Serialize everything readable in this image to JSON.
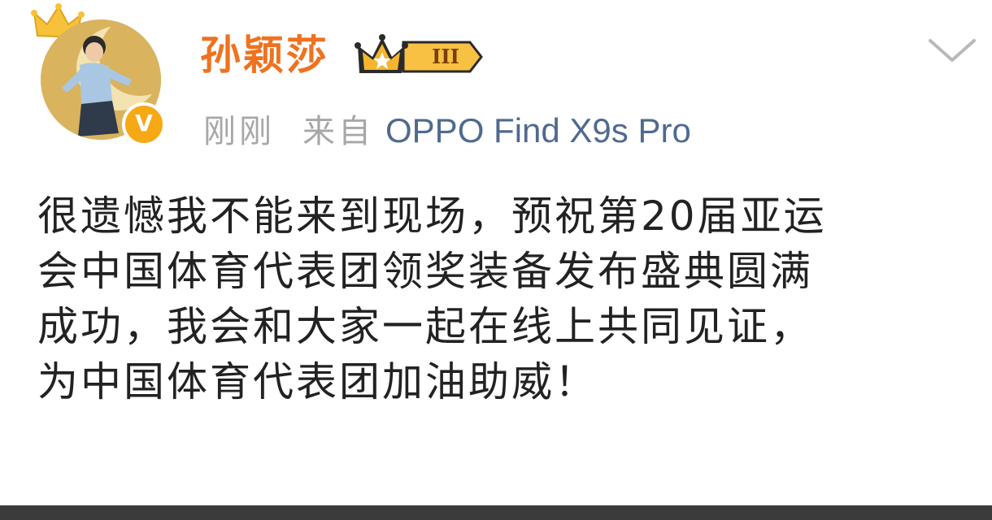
{
  "post": {
    "username": "孙颖莎",
    "member_level": "III",
    "timestamp": "刚刚",
    "source_prefix": "来自",
    "device": "OPPO Find X9s Pro",
    "text": "很遗憾我不能来到现场，预祝第20届亚运\n会中国体育代表团领奖装备发布盛典圆满\n成功，我会和大家一起在线上共同见证，\n为中国体育代表团加油助威！",
    "vip_badge": "V"
  },
  "icons": {
    "avatar_frame": "crown-icon",
    "verified": "vip-badge-icon",
    "member": "crown-member-badge-icon",
    "menu": "chevron-down-icon"
  },
  "colors": {
    "username": "#ef7220",
    "device_link": "#4f6a90",
    "meta_gray": "#a7a7a7",
    "body_text": "#222222",
    "badge_gold": "#f6a914"
  }
}
